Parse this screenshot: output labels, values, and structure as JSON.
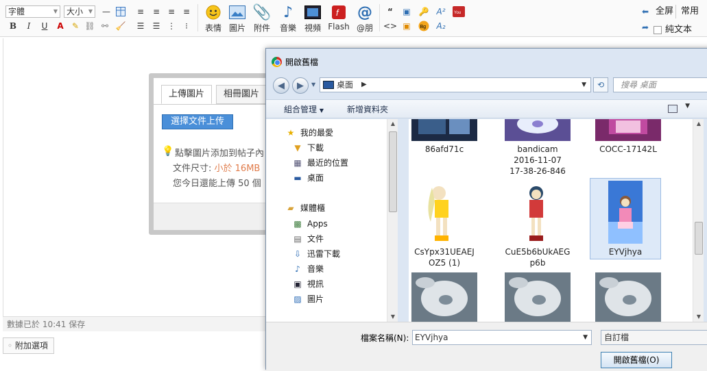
{
  "toolbar": {
    "font_select": "字體",
    "size_select": "大小",
    "bold": "B",
    "italic": "I",
    "underline": "U",
    "buttons": {
      "emoji": "表情",
      "image": "圖片",
      "attachment": "附件",
      "music": "音樂",
      "video": "視頻",
      "flash": "Flash",
      "mention": "@朋"
    },
    "fullscreen": "全屏",
    "common": "常用",
    "plaintext": "純文本"
  },
  "editor": {
    "status": "數據已於 10:41 保存",
    "extra_options": "附加選項"
  },
  "upload_popup": {
    "tab_upload": "上傳圖片",
    "tab_album": "相冊圖片",
    "choose_button": "選擇文件上传",
    "tip_line1": "點擊圖片添加到帖子內",
    "tip_size_prefix": "文件尺寸: ",
    "tip_size_value": "小於 16MB",
    "tip_line3": "您今日還能上傳 50 個"
  },
  "dialog": {
    "title": "開啟舊檔",
    "address": "桌面",
    "search_placeholder": "搜尋 桌面",
    "organize": "組合管理",
    "new_folder": "新增資料夾",
    "nav": {
      "favorites": "我的最愛",
      "downloads": "下載",
      "recent": "最近的位置",
      "desktop": "桌面",
      "libraries": "媒體櫃",
      "apps": "Apps",
      "documents": "文件",
      "thunder": "迅雷下載",
      "music": "音樂",
      "videos": "視訊",
      "pictures": "圖片"
    },
    "files": [
      {
        "name": "86afd71c",
        "kind": "dark"
      },
      {
        "name": "bandicam\n2016-11-07\n17-38-26-846",
        "kind": "storm"
      },
      {
        "name": "COCC-17142L",
        "kind": "purple"
      },
      {
        "name": "CsYpx31UEAEJ\nOZ5 (1)",
        "kind": "yellowgirl"
      },
      {
        "name": "CuE5b6bUkAEG\np6b",
        "kind": "redgirl"
      },
      {
        "name": "EYVjhya",
        "kind": "bluegirl"
      },
      {
        "name": "",
        "kind": "cloud"
      },
      {
        "name": "",
        "kind": "cloud"
      },
      {
        "name": "",
        "kind": "cloud"
      }
    ],
    "filename_label": "檔案名稱(N):",
    "filename_value": "EYVjhya",
    "filetype": "自訂檔",
    "open_button": "開啟舊檔(O)"
  },
  "colors": {
    "accent_blue": "#4a8fd9",
    "orange_text": "#e07b4a",
    "dialog_frame": "#dce6f3"
  }
}
